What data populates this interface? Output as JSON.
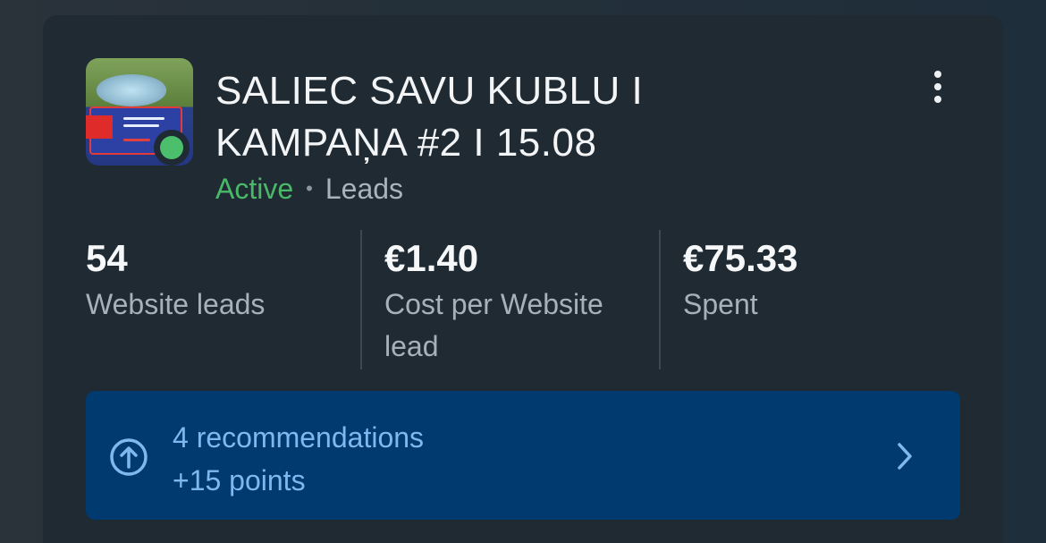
{
  "campaign": {
    "title_line1": "SALIEC SAVU KUBLU I",
    "title_line2": "KAMPAŅA #2 I 15.08",
    "status": "Active",
    "separator": "•",
    "objective": "Leads"
  },
  "metrics": [
    {
      "value": "54",
      "label": "Website leads"
    },
    {
      "value": "€1.40",
      "label": "Cost per Website lead"
    },
    {
      "value": "€75.33",
      "label": "Spent"
    }
  ],
  "recommendations": {
    "line1": "4 recommendations",
    "line2": "+15 points"
  },
  "colors": {
    "active": "#49b869",
    "accent_panel": "#003a6e",
    "accent_text": "#7fb8ee"
  },
  "icons": [
    "kebab-menu-icon",
    "arrow-up-circle-icon",
    "chevron-right-icon",
    "status-dot-icon"
  ]
}
